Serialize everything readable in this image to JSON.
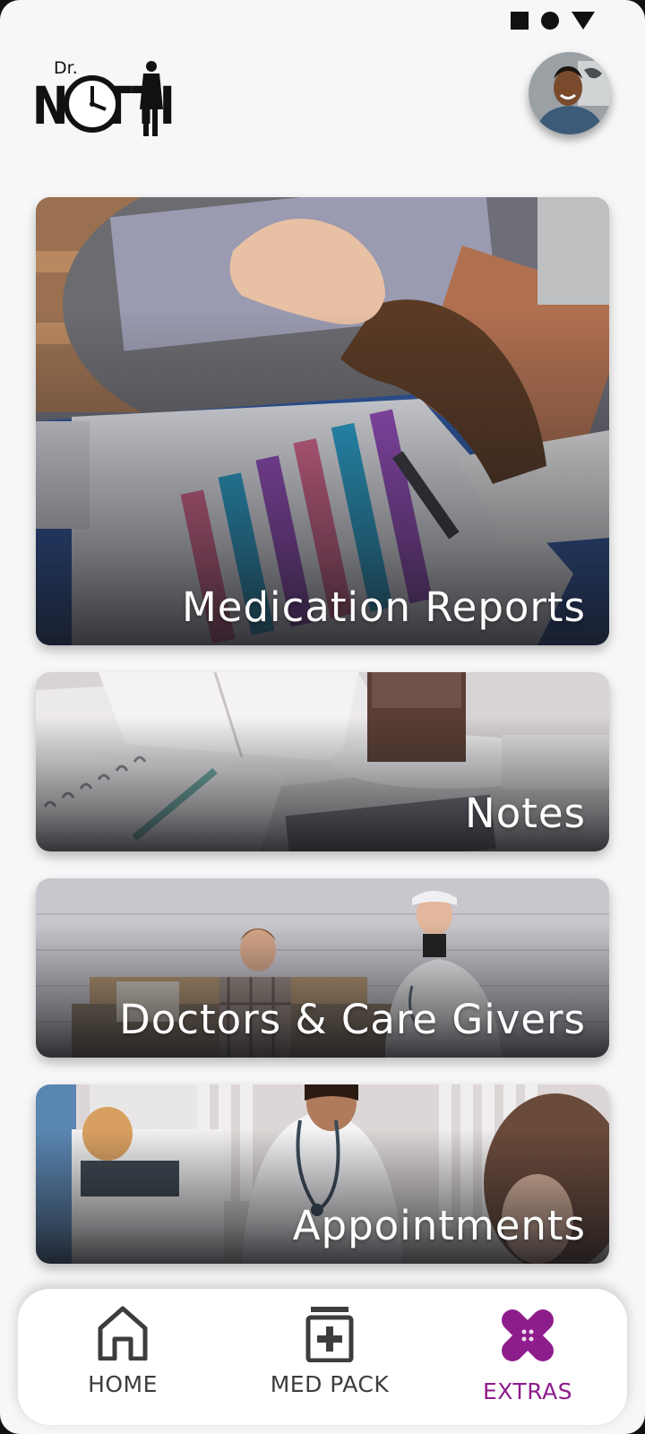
{
  "app": {
    "logo_prefix": "Dr.",
    "logo_name": "NOTTI"
  },
  "status_bar": {
    "icons": [
      "square-icon",
      "circle-icon",
      "triangle-icon"
    ]
  },
  "cards": [
    {
      "id": "medication-reports",
      "label": "Medication Reports"
    },
    {
      "id": "notes",
      "label": "Notes"
    },
    {
      "id": "doctors-care-givers",
      "label": "Doctors & Care Givers"
    },
    {
      "id": "appointments",
      "label": "Appointments"
    }
  ],
  "bottom_nav": {
    "items": [
      {
        "label": "HOME",
        "icon": "home-icon",
        "active": false
      },
      {
        "label": "MED PACK",
        "icon": "med-pack-icon",
        "active": false
      },
      {
        "label": "EXTRAS",
        "icon": "bandage-icon",
        "active": true
      }
    ]
  },
  "colors": {
    "active": "#8e1d8c",
    "inactive": "#3d3d3d",
    "background": "#f7f7f8"
  }
}
